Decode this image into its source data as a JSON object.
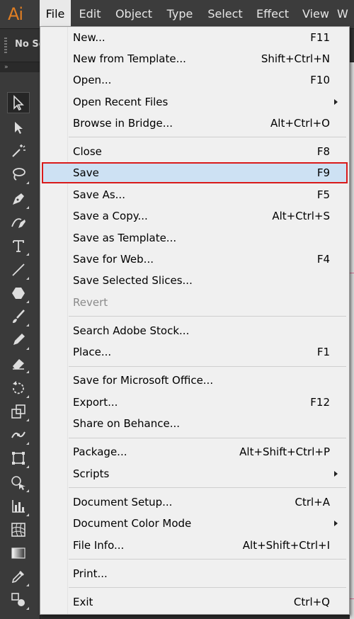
{
  "app": {
    "logo": "Ai"
  },
  "menubar": {
    "items": [
      {
        "label": "File"
      },
      {
        "label": "Edit"
      },
      {
        "label": "Object"
      },
      {
        "label": "Type"
      },
      {
        "label": "Select"
      },
      {
        "label": "Effect"
      },
      {
        "label": "View"
      },
      {
        "label": "W"
      }
    ]
  },
  "controlbar": {
    "selection": "No Se"
  },
  "toolpanel": {
    "tools": [
      "selection-tool",
      "direct-selection-tool",
      "magic-wand-tool",
      "lasso-tool",
      "pen-tool",
      "curvature-tool",
      "type-tool",
      "line-segment-tool",
      "polygon-tool",
      "paintbrush-tool",
      "pencil-tool",
      "eraser-tool",
      "rotate-tool",
      "scale-tool",
      "width-tool",
      "free-transform-tool",
      "shape-builder-tool",
      "graph-tool",
      "mesh-tool",
      "gradient-tool",
      "eyedropper-tool",
      "blend-tool"
    ]
  },
  "file_menu": {
    "items": [
      {
        "label": "New...",
        "shortcut": "F11"
      },
      {
        "label": "New from Template...",
        "shortcut": "Shift+Ctrl+N"
      },
      {
        "label": "Open...",
        "shortcut": "F10"
      },
      {
        "label": "Open Recent Files",
        "shortcut": ""
      },
      {
        "label": "Browse in Bridge...",
        "shortcut": "Alt+Ctrl+O"
      },
      {
        "label": "Close",
        "shortcut": "F8"
      },
      {
        "label": "Save",
        "shortcut": "F9"
      },
      {
        "label": "Save As...",
        "shortcut": "F5"
      },
      {
        "label": "Save a Copy...",
        "shortcut": "Alt+Ctrl+S"
      },
      {
        "label": "Save as Template...",
        "shortcut": ""
      },
      {
        "label": "Save for Web...",
        "shortcut": "F4"
      },
      {
        "label": "Save Selected Slices...",
        "shortcut": ""
      },
      {
        "label": "Revert",
        "shortcut": ""
      },
      {
        "label": "Search Adobe Stock...",
        "shortcut": ""
      },
      {
        "label": "Place...",
        "shortcut": "F1"
      },
      {
        "label": "Save for Microsoft Office...",
        "shortcut": ""
      },
      {
        "label": "Export...",
        "shortcut": "F12"
      },
      {
        "label": "Share on Behance...",
        "shortcut": ""
      },
      {
        "label": "Package...",
        "shortcut": "Alt+Shift+Ctrl+P"
      },
      {
        "label": "Scripts",
        "shortcut": ""
      },
      {
        "label": "Document Setup...",
        "shortcut": "Ctrl+A"
      },
      {
        "label": "Document Color Mode",
        "shortcut": ""
      },
      {
        "label": "File Info...",
        "shortcut": "Alt+Shift+Ctrl+I"
      },
      {
        "label": "Print...",
        "shortcut": ""
      },
      {
        "label": "Exit",
        "shortcut": "Ctrl+Q"
      }
    ]
  },
  "colors": {
    "accent": "#d91a1a",
    "highlight": "#cde1f3",
    "logo": "#e07e23"
  }
}
